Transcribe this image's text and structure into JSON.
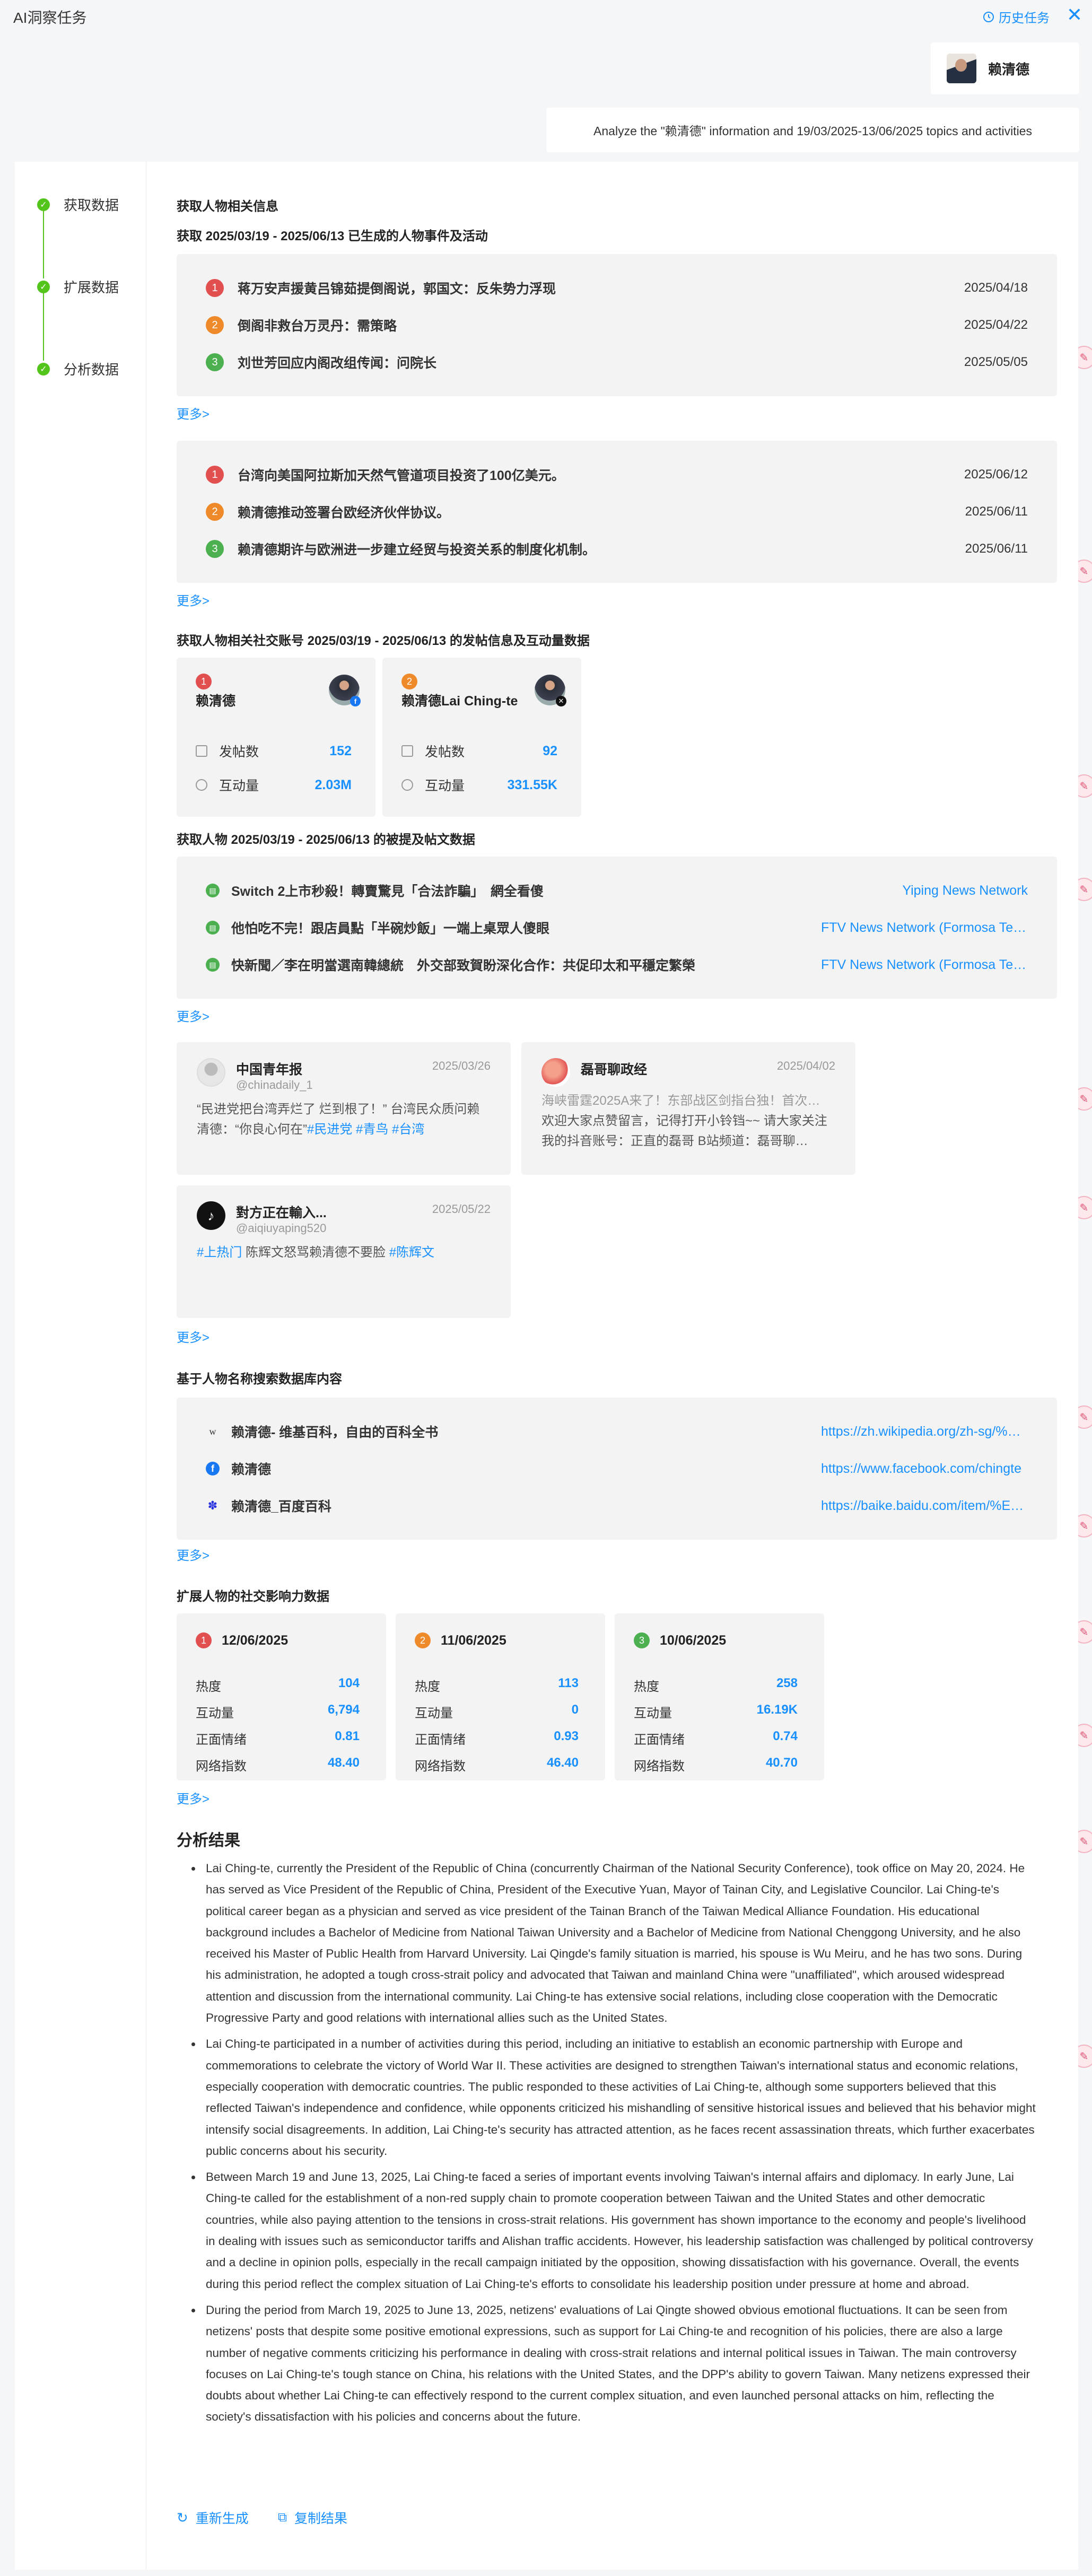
{
  "app": {
    "title": "AI洞察任务",
    "history_label": "历史任务"
  },
  "user": {
    "name": "赖清德"
  },
  "query": "Analyze the \"赖清德\" information and 19/03/2025-13/06/2025 topics and activities",
  "steps": [
    "获取数据",
    "扩展数据",
    "分析数据"
  ],
  "section1": {
    "title": "获取人物相关信息",
    "subtitle": "获取 2025/03/19 - 2025/06/13 已生成的人物事件及活动",
    "group1": [
      {
        "n": "1",
        "title": "蒋万安声援黄吕锦茹提倒阁说，郭国文：反朱势力浮现",
        "date": "2025/04/18"
      },
      {
        "n": "2",
        "title": "倒阁非救台万灵丹：需策略",
        "date": "2025/04/22"
      },
      {
        "n": "3",
        "title": "刘世芳回应内阁改组传闻：问院长",
        "date": "2025/05/05"
      }
    ],
    "group2": [
      {
        "n": "1",
        "title": "台湾向美国阿拉斯加天然气管道项目投资了100亿美元。",
        "date": "2025/06/12"
      },
      {
        "n": "2",
        "title": "赖清德推动签署台欧经济伙伴协议。",
        "date": "2025/06/11"
      },
      {
        "n": "3",
        "title": "赖清德期许与欧洲进一步建立经贸与投资关系的制度化机制。",
        "date": "2025/06/11"
      }
    ],
    "more": "更多>"
  },
  "social": {
    "title": "获取人物相关社交账号 2025/03/19 - 2025/06/13 的发帖信息及互动量数据",
    "post_count_label": "发帖数",
    "interaction_label": "互动量",
    "accounts": [
      {
        "n": "1",
        "name": "赖清德",
        "posts": "152",
        "interactions": "2.03M",
        "badge_color": "#1877f2"
      },
      {
        "n": "2",
        "name": "赖清德Lai Ching-te",
        "posts": "92",
        "interactions": "331.55K",
        "badge_color": "#111111"
      }
    ]
  },
  "mentions": {
    "title": "获取人物 2025/03/19 - 2025/06/13 的被提及帖文数据",
    "posts": [
      {
        "title": "Switch 2上市秒殺！轉賣驚見「合法詐騙」　網全看傻",
        "source": "Yiping News Network"
      },
      {
        "title": "他怕吃不完！跟店員點「半碗炒飯」一端上桌眾人傻眼",
        "source": "FTV News Network (Formosa Television)"
      },
      {
        "title": "快新聞／李在明當選南韓總統　外交部致賀盼深化合作：共促印太和平穩定繁榮",
        "source": "FTV News Network (Formosa Television)"
      }
    ],
    "cards": [
      {
        "name": "中国青年报",
        "handle": "@chinadaily_1",
        "date": "2025/03/26",
        "text": "“民进党把台湾弄烂了 烂到根了！” 台湾民众质问赖清德：“你良心何在”",
        "tags": "#民进党 #青鸟 #台湾"
      },
      {
        "name": "磊哥聊政经",
        "handle": "",
        "date": "2025/04/02",
        "text": "海峡雷霆2025A来了！东部战区剑指台独！首次…",
        "text2": "欢迎大家点赞留言，记得打开小铃铛~~ 请大家关注我的抖音账号：正直的磊哥 B站频道：磊哥聊…",
        "tags": ""
      },
      {
        "name": "對方正在輸入...",
        "handle": "@aiqiuyaping520",
        "date": "2025/05/22",
        "text": "陈辉文怒骂赖清德不要脸",
        "tag_before": "#上热门",
        "tags": "#陈辉文"
      }
    ]
  },
  "search": {
    "title": "基于人物名称搜索数据库内容",
    "results": [
      {
        "icon": "W",
        "title": "赖清德- 维基百科，自由的百科全书",
        "url": "https://zh.wikipedia.org/zh-sg/%E8%B5%96%E6%B8%85%E5%BE%B7"
      },
      {
        "icon": "f",
        "title": "赖清德",
        "url": "https://www.facebook.com/chingte"
      },
      {
        "icon": "du",
        "title": "赖清德_百度百科",
        "url": "https://baike.baidu.com/item/%E8%B5%96%E6%B8%85%E5%BE%B7"
      }
    ]
  },
  "impact": {
    "title": "扩展人物的社交影响力数据",
    "labels": [
      "热度",
      "互动量",
      "正面情绪",
      "网络指数"
    ],
    "items": [
      {
        "n": "1",
        "date": "12/06/2025",
        "values": [
          "104",
          "6,794",
          "0.81",
          "48.40"
        ]
      },
      {
        "n": "2",
        "date": "11/06/2025",
        "values": [
          "113",
          "0",
          "0.93",
          "46.40"
        ]
      },
      {
        "n": "3",
        "date": "10/06/2025",
        "values": [
          "258",
          "16.19K",
          "0.74",
          "40.70"
        ]
      }
    ]
  },
  "result": {
    "title": "分析结果",
    "paragraphs": [
      "Lai Ching-te, currently the President of the Republic of China (concurrently Chairman of the National Security Conference), took office on May 20, 2024. He has served as Vice President of the Republic of China, President of the Executive Yuan, Mayor of Tainan City, and Legislative Councilor. Lai Ching-te's political career began as a physician and served as vice president of the Tainan Branch of the Taiwan Medical Alliance Foundation. His educational background includes a Bachelor of Medicine from National Taiwan University and a Bachelor of Medicine from National Chenggong University, and he also received his Master of Public Health from Harvard University. Lai Qingde's family situation is married, his spouse is Wu Meiru, and he has two sons. During his administration, he adopted a tough cross-strait policy and advocated that Taiwan and mainland China were \"unaffiliated\", which aroused widespread attention and discussion from the international community. Lai Ching-te has extensive social relations, including close cooperation with the Democratic Progressive Party and good relations with international allies such as the United States.",
      "Lai Ching-te participated in a number of activities during this period, including an initiative to establish an economic partnership with Europe and commemorations to celebrate the victory of World War II. These activities are designed to strengthen Taiwan's international status and economic relations, especially cooperation with democratic countries. The public responded to these activities of Lai Ching-te, although some supporters believed that this reflected Taiwan's independence and confidence, while opponents criticized his mishandling of sensitive historical issues and believed that his behavior might intensify social disagreements. In addition, Lai Ching-te's security has attracted attention, as he faces recent assassination threats, which further exacerbates public concerns about his security.",
      "Between March 19 and June 13, 2025, Lai Ching-te faced a series of important events involving Taiwan's internal affairs and diplomacy. In early June, Lai Ching-te called for the establishment of a non-red supply chain to promote cooperation between Taiwan and the United States and other democratic countries, while also paying attention to the tensions in cross-strait relations. His government has shown importance to the economy and people's livelihood in dealing with issues such as semiconductor tariffs and Alishan traffic accidents. However, his leadership satisfaction was challenged by political controversy and a decline in opinion polls, especially in the recall campaign initiated by the opposition, showing dissatisfaction with his governance. Overall, the events during this period reflect the complex situation of Lai Ching-te's efforts to consolidate his leadership position under pressure at home and abroad.",
      "During the period from March 19, 2025 to June 13, 2025, netizens' evaluations of Lai Qingte showed obvious emotional fluctuations. It can be seen from netizens' posts that despite some positive emotional expressions, such as support for Lai Ching-te and recognition of his policies, there are also a large number of negative comments criticizing his performance in dealing with cross-strait relations and internal political issues in Taiwan. The main controversy focuses on Lai Ching-te's tough stance on China, his relations with the United States, and the DPP's ability to govern Taiwan. Many netizens expressed their doubts about whether Lai Ching-te can effectively respond to the current complex situation, and even launched personal attacks on him, reflecting the society's dissatisfaction with his policies and concerns about the future."
    ],
    "regenerate_label": "重新生成",
    "copy_label": "复制结果"
  }
}
